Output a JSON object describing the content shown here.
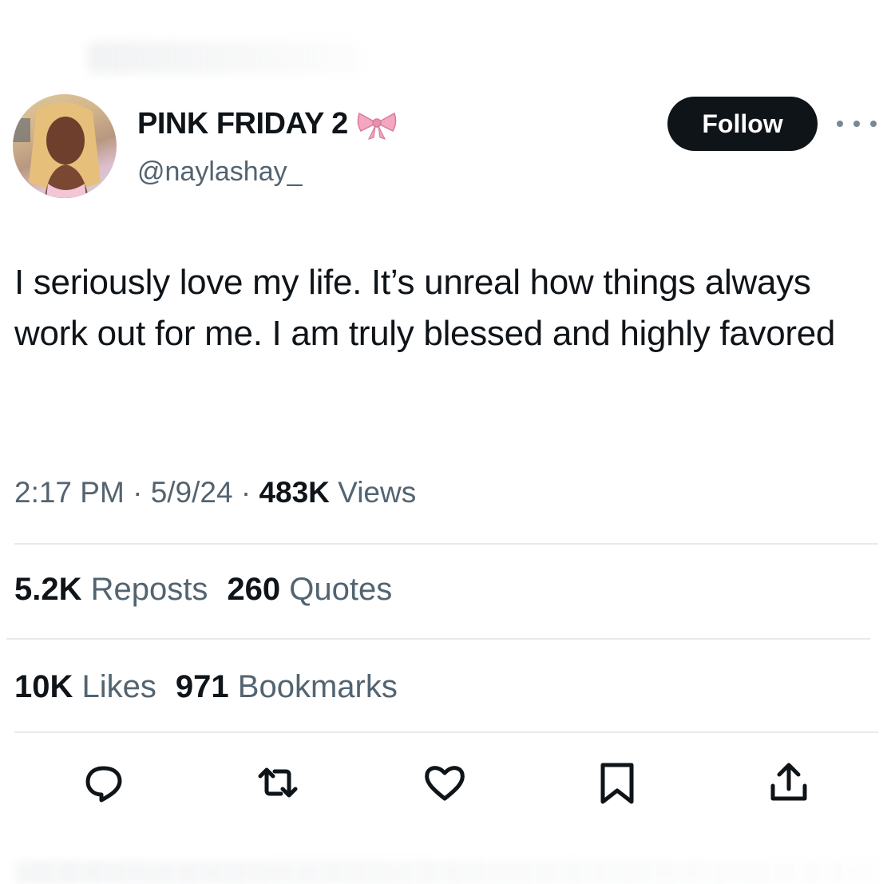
{
  "user": {
    "display_name": "PINK FRIDAY 2",
    "name_emoji": "🎀",
    "handle": "@naylashay_",
    "avatar_icon": "profile-photo"
  },
  "header": {
    "follow_label": "Follow",
    "more_icon": "ellipsis-icon"
  },
  "tweet": {
    "text": "I seriously love my life. It’s unreal how things always work out for me. I am truly blessed and highly favored"
  },
  "meta": {
    "time": "2:17 PM",
    "sep1": " · ",
    "date": "5/9/24",
    "sep2": " · ",
    "views_count": "483K",
    "views_label": " Views"
  },
  "stats": {
    "reposts_count": "5.2K",
    "reposts_label": "Reposts",
    "quotes_count": "260",
    "quotes_label": "Quotes",
    "likes_count": "10K",
    "likes_label": "Likes",
    "bookmarks_count": "971",
    "bookmarks_label": "Bookmarks"
  },
  "actions": [
    "reply-icon",
    "retweet-icon",
    "like-icon",
    "bookmark-icon",
    "share-icon"
  ],
  "colors": {
    "text": "#0f1419",
    "secondary": "#536471",
    "divider": "#e7e9ea",
    "follow_bg": "#0f1419",
    "ribbon": "#f4a7c0"
  }
}
